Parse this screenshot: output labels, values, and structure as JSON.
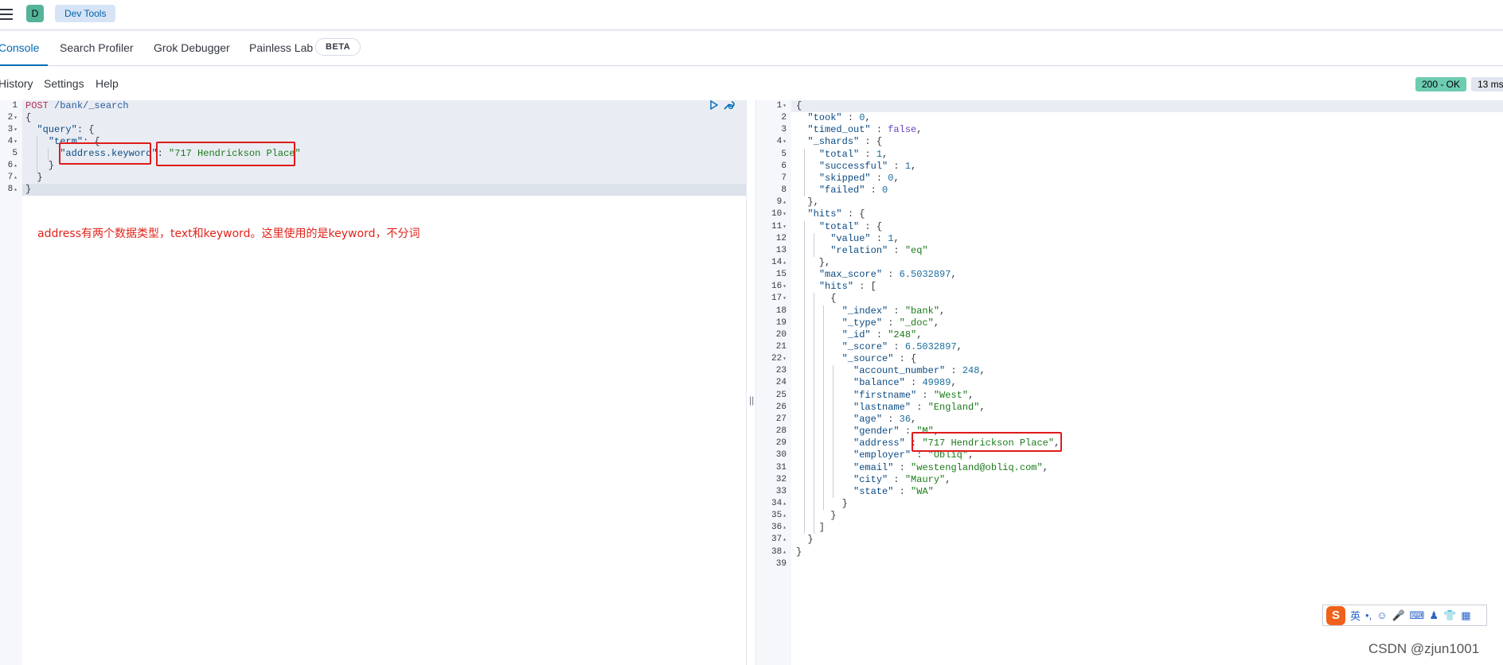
{
  "header": {
    "space_initial": "D",
    "breadcrumb": "Dev Tools"
  },
  "tabs": [
    {
      "label": "Console",
      "active": true
    },
    {
      "label": "Search Profiler",
      "active": false
    },
    {
      "label": "Grok Debugger",
      "active": false
    },
    {
      "label": "Painless Lab",
      "active": false
    }
  ],
  "beta_badge": "BETA",
  "console_toolbar": {
    "history": "History",
    "settings": "Settings",
    "help": "Help",
    "status": "200 - OK",
    "time": "13 ms"
  },
  "request": {
    "line_numbers": [
      "1",
      "2",
      "3",
      "4",
      "5",
      "6",
      "7",
      "8"
    ],
    "lines": [
      "POST /bank/_search",
      "{",
      "  \"query\": {",
      "    \"term\": {",
      "      \"address.keyword\": \"717 Hendrickson Place\"",
      "    }",
      "  }",
      "}"
    ]
  },
  "annotation": "address有两个数据类型，text和keyword。这里使用的是keyword，不分词",
  "response": {
    "line_numbers": [
      "1",
      "2",
      "3",
      "4",
      "5",
      "6",
      "7",
      "8",
      "9",
      "10",
      "11",
      "12",
      "13",
      "14",
      "15",
      "16",
      "17",
      "18",
      "19",
      "20",
      "21",
      "22",
      "23",
      "24",
      "25",
      "26",
      "27",
      "28",
      "29",
      "30",
      "31",
      "32",
      "33",
      "34",
      "35",
      "36",
      "37",
      "38",
      "39"
    ],
    "lines": [
      "{",
      "  \"took\" : 0,",
      "  \"timed_out\" : false,",
      "  \"_shards\" : {",
      "    \"total\" : 1,",
      "    \"successful\" : 1,",
      "    \"skipped\" : 0,",
      "    \"failed\" : 0",
      "  },",
      "  \"hits\" : {",
      "    \"total\" : {",
      "      \"value\" : 1,",
      "      \"relation\" : \"eq\"",
      "    },",
      "    \"max_score\" : 6.5032897,",
      "    \"hits\" : [",
      "      {",
      "        \"_index\" : \"bank\",",
      "        \"_type\" : \"_doc\",",
      "        \"_id\" : \"248\",",
      "        \"_score\" : 6.5032897,",
      "        \"_source\" : {",
      "          \"account_number\" : 248,",
      "          \"balance\" : 49989,",
      "          \"firstname\" : \"West\",",
      "          \"lastname\" : \"England\",",
      "          \"age\" : 36,",
      "          \"gender\" : \"M\",",
      "          \"address\" : \"717 Hendrickson Place\",",
      "          \"employer\" : \"Obliq\",",
      "          \"email\" : \"westengland@obliq.com\",",
      "          \"city\" : \"Maury\",",
      "          \"state\" : \"WA\"",
      "        }",
      "      }",
      "    ]",
      "  }",
      "}",
      ""
    ]
  },
  "ime_toolbar": {
    "logo": "S",
    "lang": "英",
    "items": [
      "•,",
      "☺",
      "🎤",
      "⌨",
      "♟",
      "👕",
      "▦"
    ]
  },
  "watermark": "CSDN @zjun1001",
  "colors": {
    "accent": "#006bb8",
    "status_ok": "#6dccb1",
    "annotation_red": "#e2231a"
  }
}
